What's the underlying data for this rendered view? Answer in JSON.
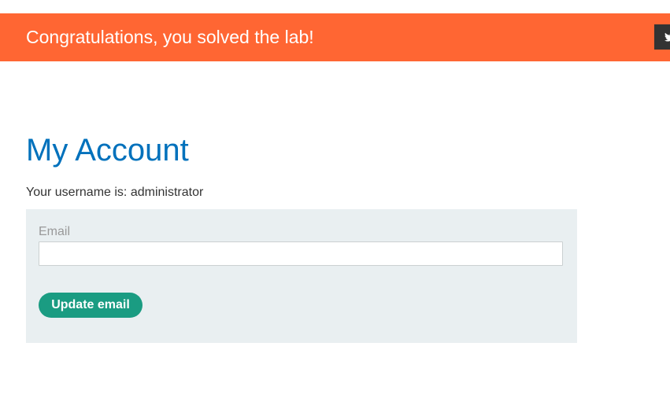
{
  "banner": {
    "message": "Congratulations, you solved the lab!",
    "share_icon": "twitter-icon",
    "background_color": "#ff6633"
  },
  "main": {
    "title": "My Account",
    "username_line": "Your username is: administrator"
  },
  "form": {
    "email_label": "Email",
    "email_value": "",
    "update_button_label": "Update email",
    "button_color": "#1a9c82",
    "panel_color": "#e9eff1"
  }
}
